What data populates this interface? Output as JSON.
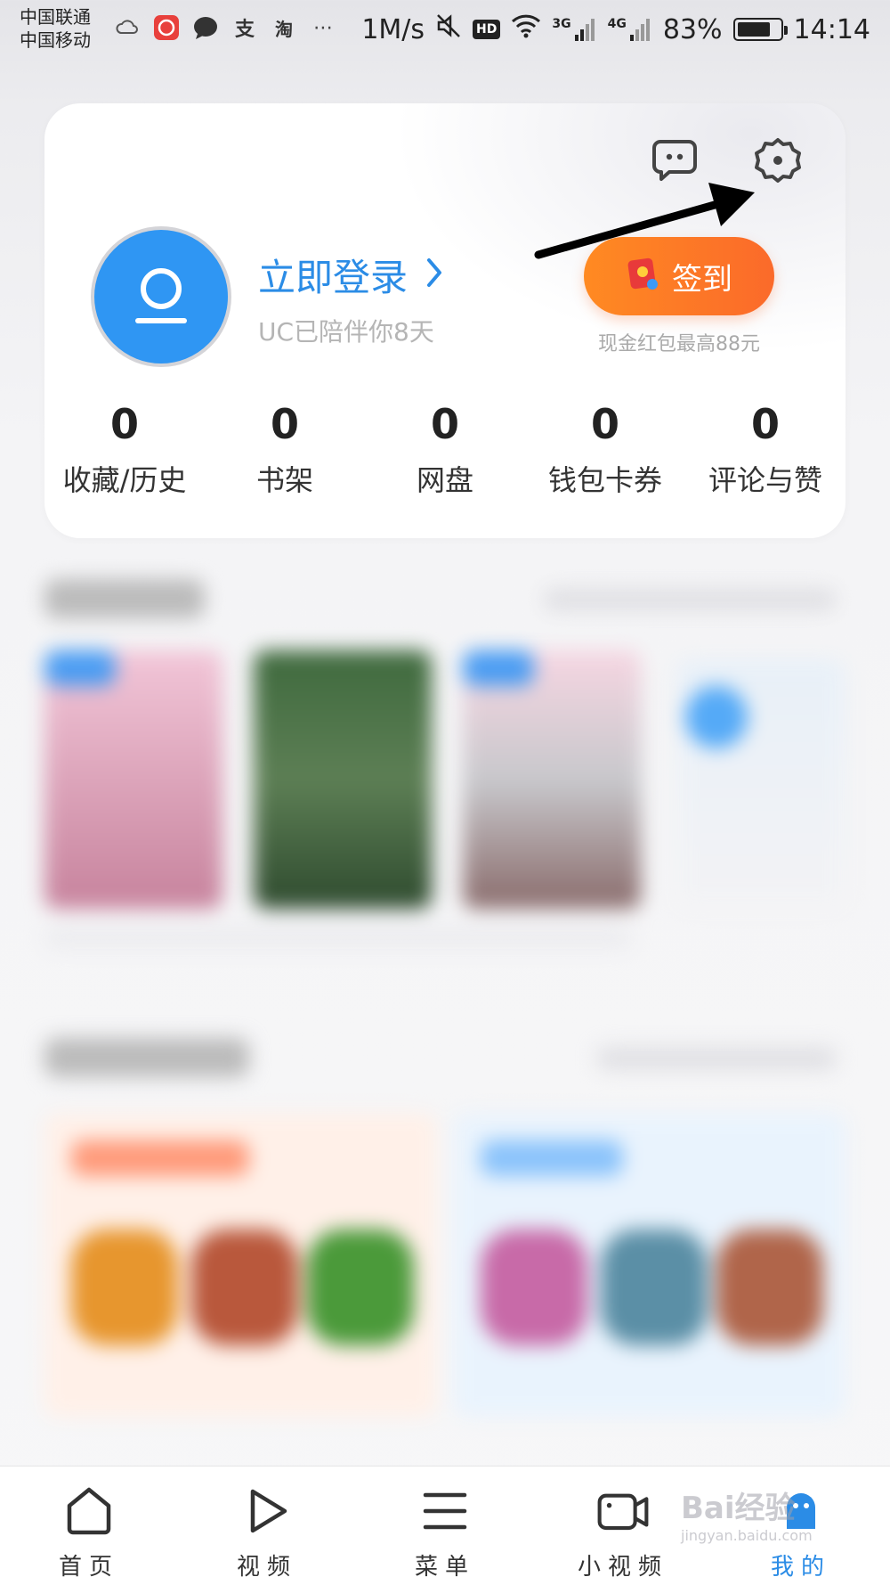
{
  "status_bar": {
    "carrier1": "中国联通",
    "carrier2": "中国移动",
    "speed": "1M/s",
    "net3g": "3G",
    "net4g": "4G",
    "battery": "83%",
    "battery_level": 0.83,
    "time": "14:14",
    "icons": [
      "weather-icon",
      "music-app-icon",
      "chat-icon",
      "alipay-icon",
      "taobao-icon",
      "more-dots-icon",
      "mute-icon",
      "hd-icon",
      "wifi-icon",
      "signal-icon"
    ]
  },
  "profile": {
    "login_label": "立即登录",
    "companion_text": "UC已陪伴你8天",
    "checkin_label": "签到",
    "checkin_sub": "现金红包最高88元"
  },
  "stats": [
    {
      "value": "0",
      "label": "收藏/历史"
    },
    {
      "value": "0",
      "label": "书架"
    },
    {
      "value": "0",
      "label": "网盘"
    },
    {
      "value": "0",
      "label": "钱包卡券"
    },
    {
      "value": "0",
      "label": "评论与赞"
    }
  ],
  "nav": [
    {
      "label": "首页",
      "icon": "home-icon"
    },
    {
      "label": "视频",
      "icon": "play-icon"
    },
    {
      "label": "菜单",
      "icon": "menu-icon"
    },
    {
      "label": "小视频",
      "icon": "short-video-icon"
    },
    {
      "label": "我的",
      "icon": "profile-face-icon"
    }
  ],
  "watermark": {
    "brand": "Bai经验",
    "url": "jingyan.baidu.com"
  },
  "colors": {
    "accent": "#2b8ce6",
    "avatar_blue": "#2f96f3",
    "checkin_orange": "#fb6a2a"
  }
}
